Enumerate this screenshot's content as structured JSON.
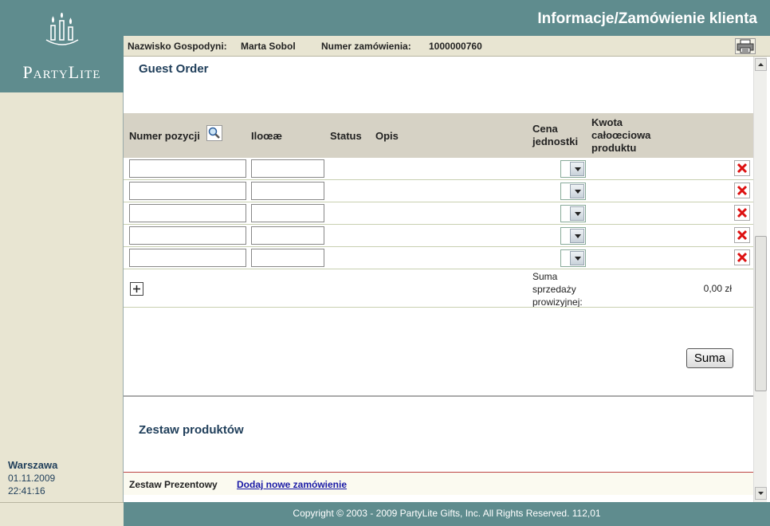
{
  "header": {
    "title": "Informacje/Zamówienie klienta"
  },
  "sidebar": {
    "logo_text": "PartyLite",
    "city": "Warszawa",
    "date": "01.11.2009",
    "time": "22:41:16"
  },
  "infobar": {
    "hostess_label": "Nazwisko Gospodyni:",
    "hostess_name": "Marta Sobol",
    "order_label": "Numer zamówienia:",
    "order_number": "1000000760",
    "print_icon": "printer-icon"
  },
  "order": {
    "section_title": "Guest Order",
    "columns": {
      "item_number": "Numer pozycji",
      "quantity": "Iloœæ",
      "status": "Status",
      "description": "Opis",
      "unit_price": "Cena jednostki",
      "total_price": "Kwota całoœciowa produktu"
    },
    "rows": [
      {
        "item": "",
        "qty": ""
      },
      {
        "item": "",
        "qty": ""
      },
      {
        "item": "",
        "qty": ""
      },
      {
        "item": "",
        "qty": ""
      },
      {
        "item": "",
        "qty": ""
      }
    ],
    "sum_label": "Suma sprzedaży prowizyjnej:",
    "sum_value": "0,00 zł",
    "sum_button": "Suma"
  },
  "product_set": {
    "title": "Zestaw produktów",
    "gift_label": "Zestaw Prezentowy",
    "gift_link": "Dodaj nowe zamówienie"
  },
  "footer": {
    "copyright": "Copyright © 2003 - 2009 PartyLite Gifts, Inc. All Rights Reserved.  112,01"
  }
}
